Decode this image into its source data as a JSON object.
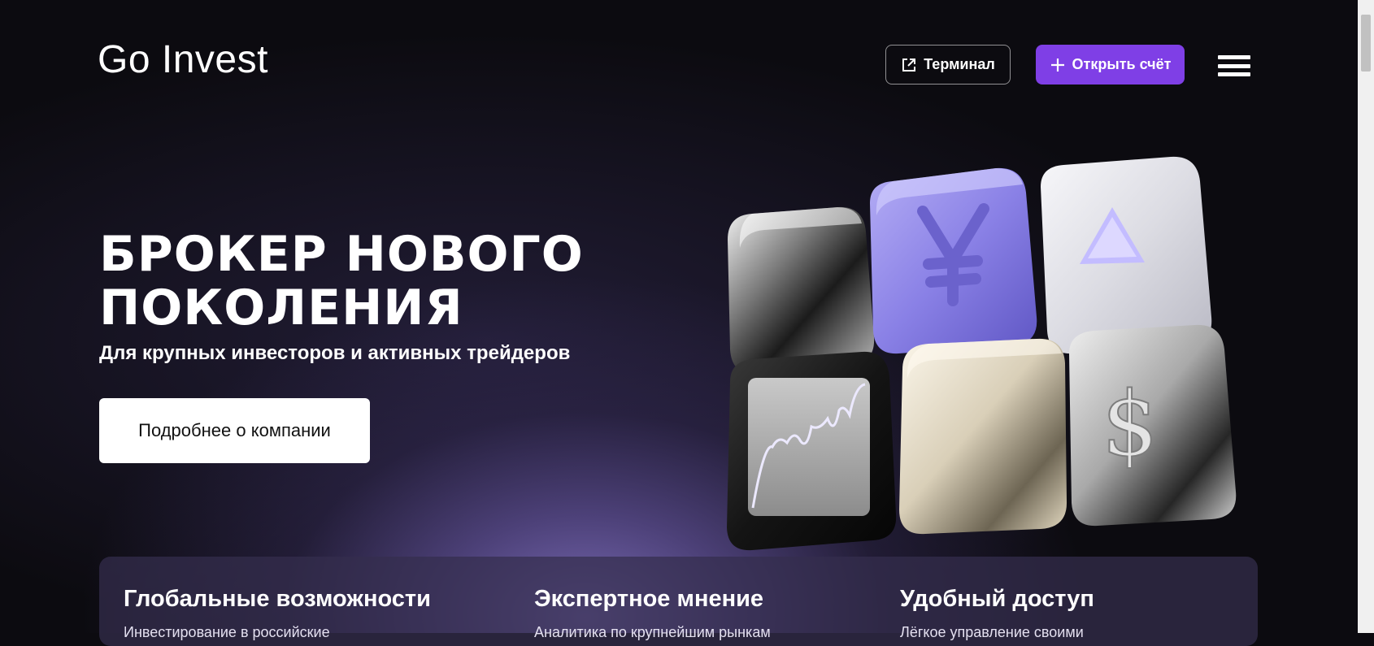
{
  "header": {
    "logo": "Go Invest",
    "terminal_label": "Терминал",
    "open_account_label": "Открыть счёт"
  },
  "hero": {
    "title_line1": "БРОКЕР НОВОГО",
    "title_line2": "ПОКОЛЕНИЯ",
    "subtitle": "Для крупных инвесторов и активных трейдеров",
    "about_button": "Подробнее о компании"
  },
  "features": [
    {
      "title": "Глобальные возможности",
      "text": "Инвестирование в российские"
    },
    {
      "title": "Экспертное мнение",
      "text": "Аналитика по крупнейшим рынкам"
    },
    {
      "title": "Удобный доступ",
      "text": "Лёгкое управление своими"
    }
  ],
  "icons": {
    "terminal": "external-link-icon",
    "open_account": "plus-icon",
    "menu": "hamburger-menu-icon"
  },
  "colors": {
    "background": "#0c0b10",
    "accent": "#7f3fe6",
    "cube_purple": "#8d85e8"
  }
}
